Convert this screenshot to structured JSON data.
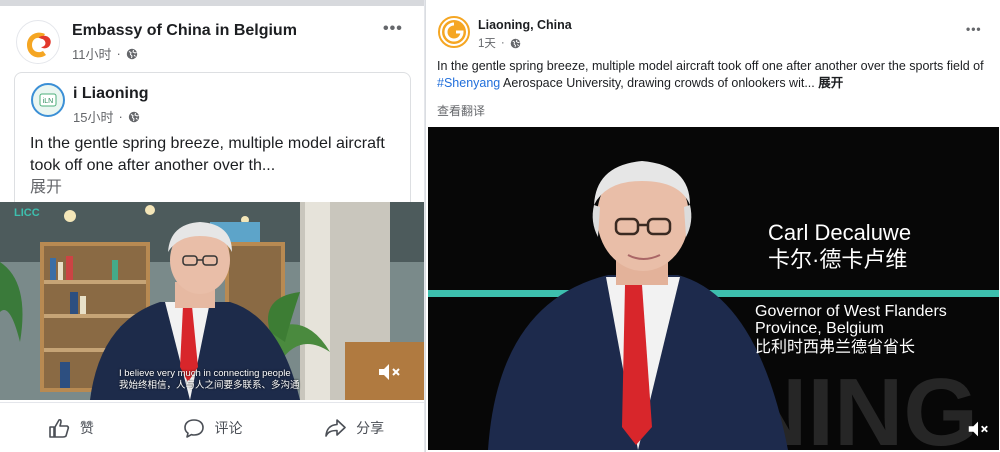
{
  "left_post": {
    "page_name": "Embassy of China in Belgium",
    "time": "11小时",
    "shared": {
      "page_name": "i Liaoning",
      "time": "15小时",
      "text": "In the gentle spring breeze, multiple model aircraft took off one after another over th...",
      "expand_label": "展开"
    },
    "video": {
      "logo_text": "LICC",
      "subtitle_en": "I believe very much in connecting people",
      "subtitle_zh": "我始终相信，人与人之间要多联系、多沟通"
    },
    "actions": {
      "like": "赞",
      "comment": "评论",
      "share": "分享"
    }
  },
  "right_post": {
    "page_name": "Liaoning, China",
    "time": "1天",
    "text_before": "In the gentle spring breeze, multiple model aircraft took off one after another over the sports field of ",
    "hashtag": "#Shenyang",
    "text_after": " Aerospace University, drawing crowds of onlookers wit... ",
    "more_label": "展开",
    "see_translation": "查看翻译",
    "video": {
      "person_name_en": "Carl Decaluwe",
      "person_name_zh": "卡尔·德卡卢维",
      "title_en_line1": "Governor of West Flanders",
      "title_en_line2": "Province, Belgium",
      "title_zh": "比利时西弗兰德省省长",
      "watermark": "NING"
    }
  },
  "colors": {
    "link": "#216fdb",
    "accent_teal": "#3dbfae",
    "tie_red": "#d8262b",
    "meta_gray": "#65676b"
  }
}
